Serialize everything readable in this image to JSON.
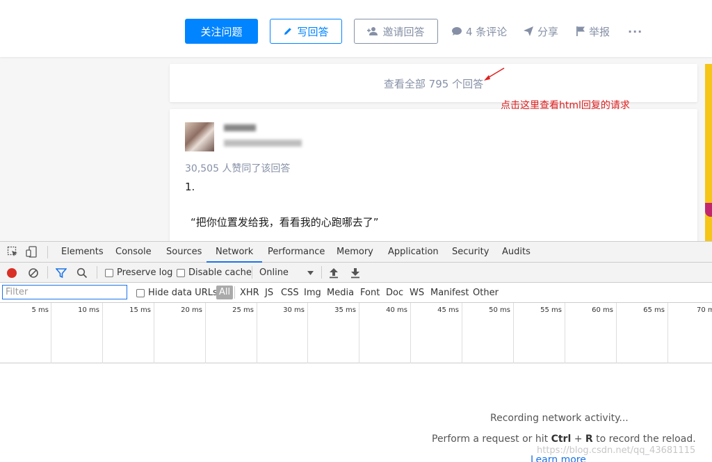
{
  "topbar": {
    "follow_button": "关注问题",
    "write_button": "写回答",
    "invite_button": "邀请回答",
    "comments": "4 条评论",
    "share": "分享",
    "report": "举报",
    "more": "···"
  },
  "content": {
    "view_all": "查看全部 795 个回答",
    "annotation": "点击这里查看html回复的请求",
    "votes": "30,505 人赞同了该回答",
    "answer_number": "1.",
    "answer_quote": "“把你位置发给我，看看我的心跑哪去了”"
  },
  "devtools": {
    "tabs": [
      "Elements",
      "Console",
      "Sources",
      "Network",
      "Performance",
      "Memory",
      "Application",
      "Security",
      "Audits"
    ],
    "active_tab": "Network",
    "toolbar": {
      "preserve_log": "Preserve log",
      "disable_cache": "Disable cache",
      "throttle": "Online"
    },
    "filter": {
      "placeholder": "Filter",
      "hide_data_urls": "Hide data URLs",
      "types": [
        "All",
        "XHR",
        "JS",
        "CSS",
        "Img",
        "Media",
        "Font",
        "Doc",
        "WS",
        "Manifest",
        "Other"
      ]
    },
    "timeline_ticks": [
      "5 ms",
      "10 ms",
      "15 ms",
      "20 ms",
      "25 ms",
      "30 ms",
      "35 ms",
      "40 ms",
      "45 ms",
      "50 ms",
      "55 ms",
      "60 ms",
      "65 ms",
      "70 m"
    ],
    "empty": {
      "recording": "Recording network activity...",
      "perform_prefix": "Perform a request or hit ",
      "shortcut_ctrl": "Ctrl",
      "shortcut_plus": " + ",
      "shortcut_r": "R",
      "perform_suffix": " to record the reload.",
      "learn_more": "Learn more"
    }
  },
  "watermark": "https://blog.csdn.net/qq_43681115",
  "colors": {
    "zhihu_blue": "#0084ff",
    "muted": "#8590a6",
    "annotation_red": "#e02020",
    "record_red": "#d93025",
    "devtools_blue": "#1a73e8"
  }
}
